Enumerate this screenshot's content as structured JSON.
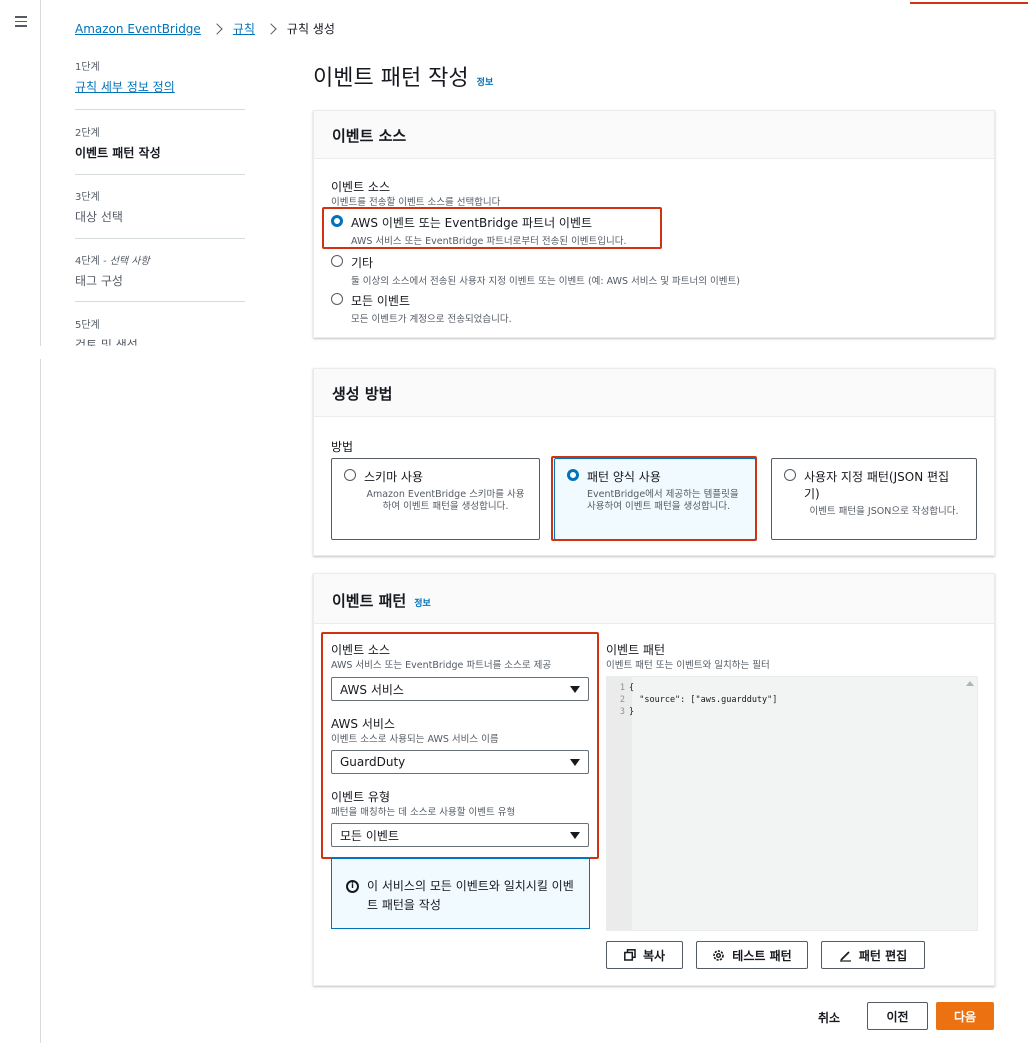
{
  "breadcrumb": [
    "Amazon EventBridge",
    "규칙",
    "규칙 생성"
  ],
  "steps": [
    {
      "num": "1단계",
      "title": "규칙 세부 정보 정의",
      "state": "link"
    },
    {
      "num": "2단계",
      "title": "이벤트 패턴 작성",
      "state": "active"
    },
    {
      "num": "3단계",
      "title": "대상 선택",
      "state": "disabled"
    },
    {
      "num": "4단계",
      "num_suffix": " - 선택 사항",
      "title": "태그 구성",
      "state": "disabled"
    },
    {
      "num": "5단계",
      "title": "검토 및 생성",
      "state": "disabled"
    }
  ],
  "page": {
    "title": "이벤트 패턴 작성",
    "info": "정보"
  },
  "event_source_panel": {
    "header": "이벤트 소스",
    "label": "이벤트 소스",
    "description": "이벤트를 전송할 이벤트 소스를 선택합니다",
    "options": [
      {
        "label": "AWS 이벤트 또는 EventBridge 파트너 이벤트",
        "description": "AWS 서비스 또는 EventBridge 파트너로부터 전송된 이벤트입니다.",
        "selected": true
      },
      {
        "label": "기타",
        "description": "둘 이상의 소스에서 전송된 사용자 지정 이벤트 또는 이벤트 (예: AWS 서비스 및 파트너의 이벤트)",
        "selected": false
      },
      {
        "label": "모든 이벤트",
        "description": "모든 이벤트가 계정으로 전송되었습니다.",
        "selected": false
      }
    ]
  },
  "creation_method_panel": {
    "header": "생성 방법",
    "label": "방법",
    "tiles": [
      {
        "label": "스키마 사용",
        "description": "Amazon EventBridge 스키마를 사용하여 이벤트 패턴을 생성합니다.",
        "selected": false
      },
      {
        "label": "패턴 양식 사용",
        "description": "EventBridge에서 제공하는 템플릿을 사용하여 이벤트 패턴을 생성합니다.",
        "selected": true
      },
      {
        "label": "사용자 지정 패턴(JSON 편집기)",
        "description": "이벤트 패턴을 JSON으로 작성합니다.",
        "selected": false
      }
    ]
  },
  "event_pattern_panel": {
    "header": "이벤트 패턴",
    "info": "정보",
    "fields": [
      {
        "label": "이벤트 소스",
        "description": "AWS 서비스 또는 EventBridge 파트너를 소스로 제공",
        "value": "AWS 서비스"
      },
      {
        "label": "AWS 서비스",
        "description": "이벤트 소스로 사용되는 AWS 서비스 이름",
        "value": "GuardDuty"
      },
      {
        "label": "이벤트 유형",
        "description": "패턴을 매칭하는 데 소스로 사용할 이벤트 유형",
        "value": "모든 이벤트"
      }
    ],
    "alert": "이 서비스의 모든 이벤트와 일치시킬 이벤트 패턴을 작성",
    "pattern_label": "이벤트 패턴",
    "pattern_description": "이벤트 패턴 또는 이벤트와 일치하는 필터",
    "code_lines": [
      "{",
      "  \"source\": [\"aws.guardduty\"]",
      "}"
    ],
    "buttons": {
      "copy": "복사",
      "test": "테스트 패턴",
      "edit": "패턴 편집"
    }
  },
  "footer": {
    "cancel": "취소",
    "previous": "이전",
    "next": "다음"
  },
  "colors": {
    "accent": "#0073bb",
    "highlight": "#d13212",
    "primary": "#ec7211"
  }
}
